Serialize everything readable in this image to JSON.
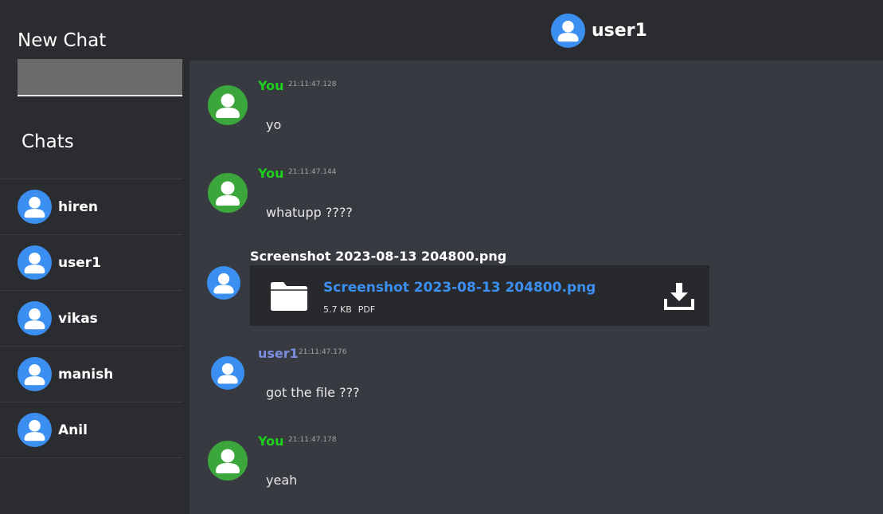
{
  "sidebar": {
    "new_chat_title": "New Chat",
    "new_chat_input_value": "",
    "chats_title": "Chats",
    "chats": [
      {
        "name": "hiren"
      },
      {
        "name": "user1"
      },
      {
        "name": "vikas"
      },
      {
        "name": "manish"
      },
      {
        "name": "Anil"
      }
    ]
  },
  "header": {
    "user_name": "user1"
  },
  "messages": [
    {
      "sender": "You",
      "time": "21:11:47.128",
      "text": "yo"
    },
    {
      "sender": "You",
      "time": "21:11:47.144",
      "text": "whatupp ????"
    },
    {
      "file_caption": "Screenshot 2023-08-13 204800.png",
      "file_name": "Screenshot 2023-08-13 204800.png",
      "file_size": "5.7 KB",
      "file_type": "PDF"
    },
    {
      "sender": "user1",
      "time": "21:11:47.176",
      "text": "got the file ???"
    },
    {
      "sender": "You",
      "time": "21:11:47.178",
      "text": "yeah"
    }
  ],
  "colors": {
    "sidebar_bg": "#2b2c30",
    "chat_bg": "#383a41",
    "self_avatar": "#3ba63b",
    "other_avatar": "#3b8ff0",
    "self_name": "#1ed01e",
    "other_name": "#7a8ee0",
    "link": "#3b8ff0"
  },
  "icons": {
    "user_avatar": "user-avatar-icon",
    "file": "folder-icon",
    "download": "download-icon"
  }
}
